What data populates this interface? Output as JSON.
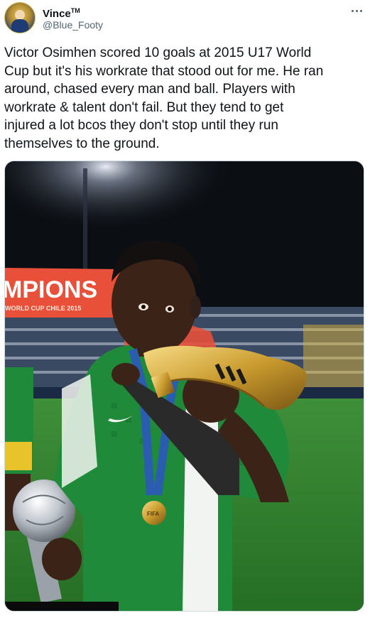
{
  "author": {
    "display_name": "Vince",
    "display_name_suffix": "TM",
    "handle": "@Blue_Footy",
    "avatar_icon": "avatar-icon"
  },
  "tweet": {
    "text_lines": [
      "Victor Osimhen scored 10 goals at 2015 U17 World",
      "Cup but it's his workrate that stood out for me. He ran",
      "around, chased every man and ball. Players with",
      "workrate & talent don't fail. But they tend to get",
      "injured a lot bcos they don't stop until they run",
      "themselves to the ground."
    ],
    "more_icon": "more-horizontal-icon"
  },
  "media": {
    "banner_text": "MPIONS",
    "banner_subtext": "WORLD CUP CHILE 2015",
    "medal_text": "FIFA",
    "colors": {
      "banner": "#e8503a",
      "jersey_green": "#1f8a3a",
      "jersey_white": "#f2f4f1",
      "pitch": "#2f7d2d",
      "gold": "#c99a2e",
      "skin": "#3b2318",
      "lanyard": "#2a5db0"
    }
  }
}
